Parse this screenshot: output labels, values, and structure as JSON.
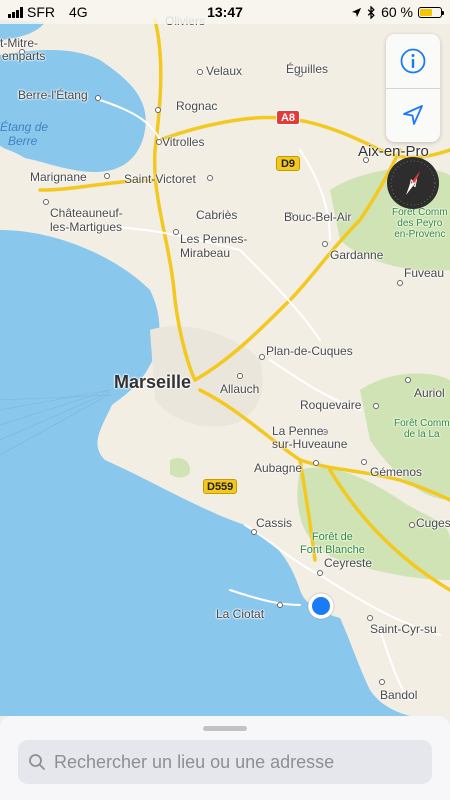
{
  "status_bar": {
    "carrier": "SFR",
    "network": "4G",
    "time": "13:47",
    "battery_percent_label": "60 %",
    "battery_level": 0.6
  },
  "map": {
    "places": [
      {
        "name": "Oliviers"
      },
      {
        "name": "Velaux"
      },
      {
        "name": "Éguilles"
      },
      {
        "name": "t-Mitre-"
      },
      {
        "name": "emparts"
      },
      {
        "name": "Berre-l'Étang"
      },
      {
        "name": "Rognac"
      },
      {
        "name": "Vitrolles"
      },
      {
        "name": "Aix-en-Pro"
      },
      {
        "name": "Marignane"
      },
      {
        "name": "Saint-Victoret"
      },
      {
        "name": "Châteauneuf-"
      },
      {
        "name": "les-Martigues"
      },
      {
        "name": "Cabriès"
      },
      {
        "name": "Bouc-Bel-Air"
      },
      {
        "name": "Les Pennes-"
      },
      {
        "name": "Mirabeau"
      },
      {
        "name": "Gardanne"
      },
      {
        "name": "Fuveau"
      },
      {
        "name": "Marseille"
      },
      {
        "name": "Plan-de-Cuques"
      },
      {
        "name": "Allauch"
      },
      {
        "name": "Auriol"
      },
      {
        "name": "Roquevaire"
      },
      {
        "name": "La Penne-"
      },
      {
        "name": "sur-Huveaune"
      },
      {
        "name": "Aubagne"
      },
      {
        "name": "Gémenos"
      },
      {
        "name": "Cassis"
      },
      {
        "name": "Cuges"
      },
      {
        "name": "Ceyreste"
      },
      {
        "name": "La Ciotat"
      },
      {
        "name": "Saint-Cyr-su"
      },
      {
        "name": "Bandol"
      }
    ],
    "water_labels": [
      "Étang de",
      "Berre"
    ],
    "forest_labels": [
      {
        "lines": [
          "Forêt Comm",
          "des Peyro",
          "en-Provenc"
        ]
      },
      {
        "lines": [
          "Forêt Comm",
          "de la La"
        ]
      },
      {
        "lines": [
          "Forêt de",
          "Font Blanche"
        ]
      }
    ],
    "road_shields": [
      {
        "label": "A8",
        "color": "#e23b3b"
      },
      {
        "label": "D9",
        "color": "#f3c81f"
      },
      {
        "label": "D559",
        "color": "#f3c81f"
      }
    ]
  },
  "controls": {
    "info_icon": "info-icon",
    "location_icon": "location-arrow-icon",
    "compass_letter": "N",
    "compass_icon": "compass-icon"
  },
  "search": {
    "placeholder": "Rechercher un lieu ou une adresse",
    "icon": "search-icon"
  },
  "colors": {
    "land": "#f2eee4",
    "water": "#8ac7ec",
    "forest": "#cfe3b4",
    "highway": "#f3c81f",
    "road": "#ffffff",
    "user_location": "#1a7cf5",
    "ui_accent": "#1a7cf5"
  }
}
